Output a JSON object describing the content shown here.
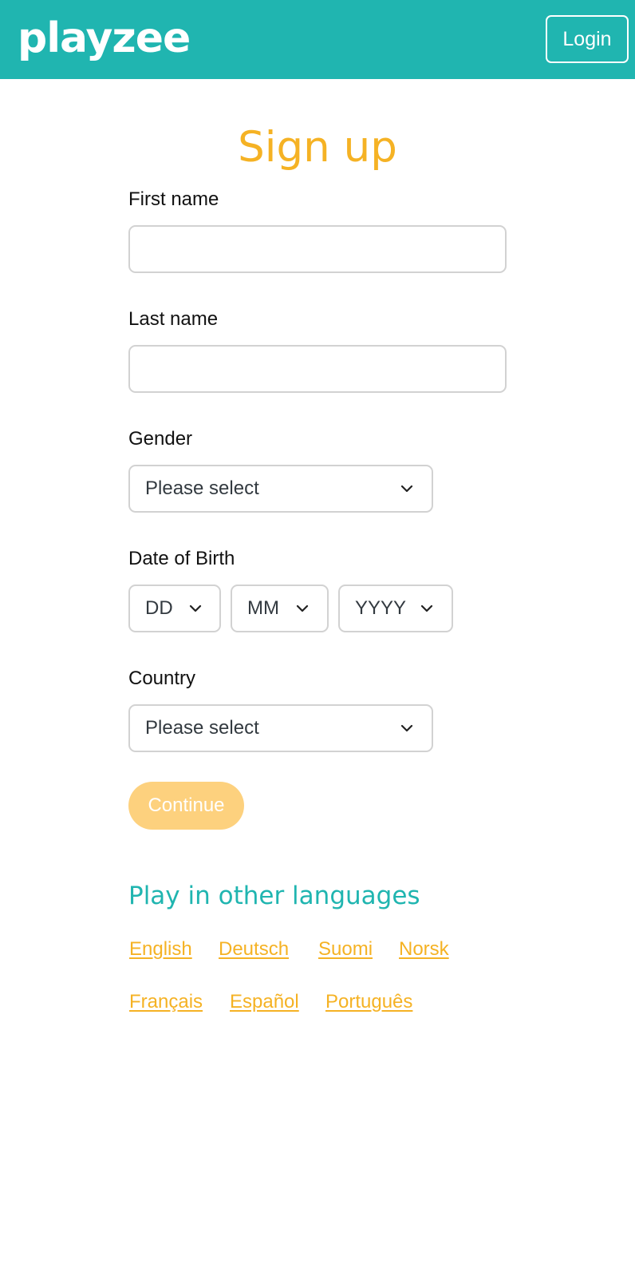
{
  "header": {
    "logo": "playzee",
    "login_label": "Login"
  },
  "form": {
    "title": "Sign up",
    "first_name": {
      "label": "First name",
      "value": "",
      "placeholder": ""
    },
    "last_name": {
      "label": "Last name",
      "value": "",
      "placeholder": ""
    },
    "gender": {
      "label": "Gender",
      "selected": "Please select"
    },
    "dob": {
      "label": "Date of Birth",
      "day": "DD",
      "month": "MM",
      "year": "YYYY"
    },
    "country": {
      "label": "Country",
      "selected": "Please select"
    },
    "continue_label": "Continue"
  },
  "languages": {
    "heading": "Play in other languages",
    "links": [
      "English",
      "Deutsch",
      "Suomi",
      "Norsk",
      "Français",
      "Español",
      "Português"
    ]
  },
  "colors": {
    "brand_teal": "#20b5b0",
    "accent_yellow": "#f5b224",
    "button_disabled": "#fdd17e"
  }
}
